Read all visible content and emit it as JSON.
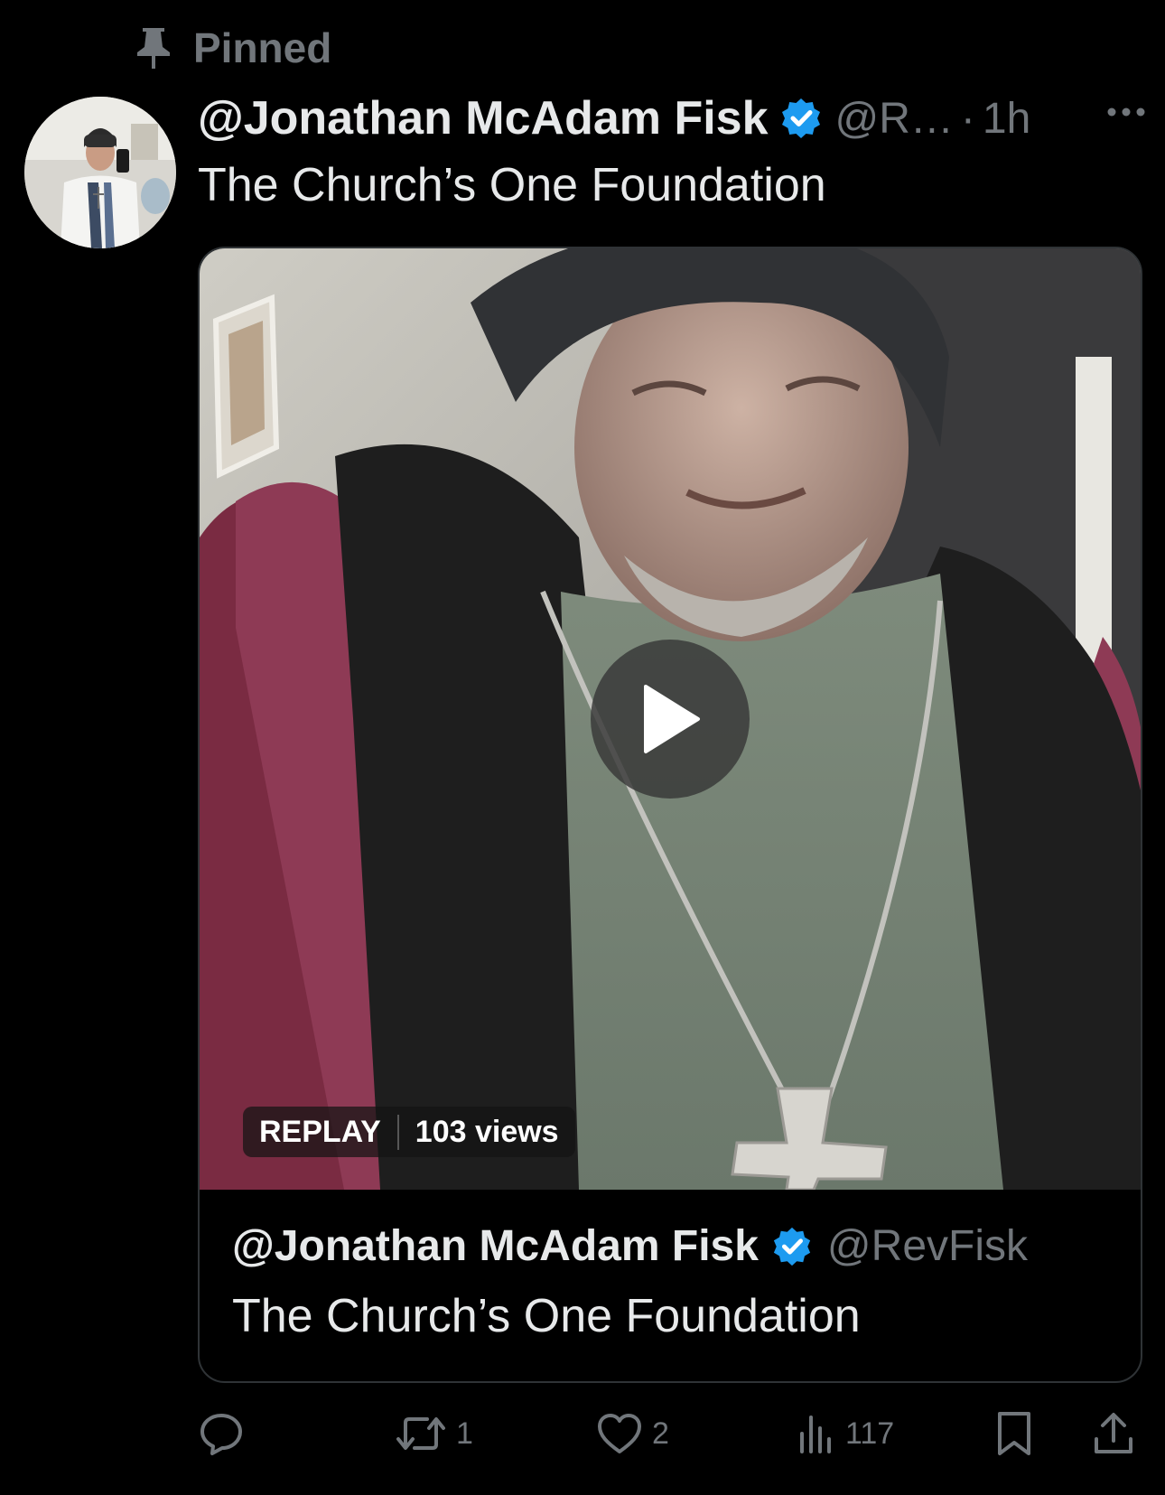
{
  "pinned": {
    "label": "Pinned"
  },
  "tweet": {
    "display_name": "@Jonathan McAdam Fisk",
    "handle": "@R…",
    "separator": "·",
    "time": "1h",
    "text": "The Church’s One Foundation"
  },
  "video": {
    "replay_label": "REPLAY",
    "views_label": "103 views"
  },
  "quote": {
    "display_name": "@Jonathan McAdam Fisk",
    "handle": "@RevFisk",
    "text": "The Church’s One Foundation"
  },
  "actions": {
    "reply_count": "",
    "retweet_count": "1",
    "like_count": "2",
    "views_count": "117"
  },
  "colors": {
    "background": "#000000",
    "primary_text": "#e7e9ea",
    "secondary_text": "#71767b",
    "verified_blue": "#1d9bf0",
    "border": "#2f3336"
  },
  "icons": [
    "pin-icon",
    "verified-icon",
    "more-icon",
    "play-icon",
    "reply-icon",
    "retweet-icon",
    "like-icon",
    "views-icon",
    "bookmark-icon",
    "share-icon"
  ]
}
